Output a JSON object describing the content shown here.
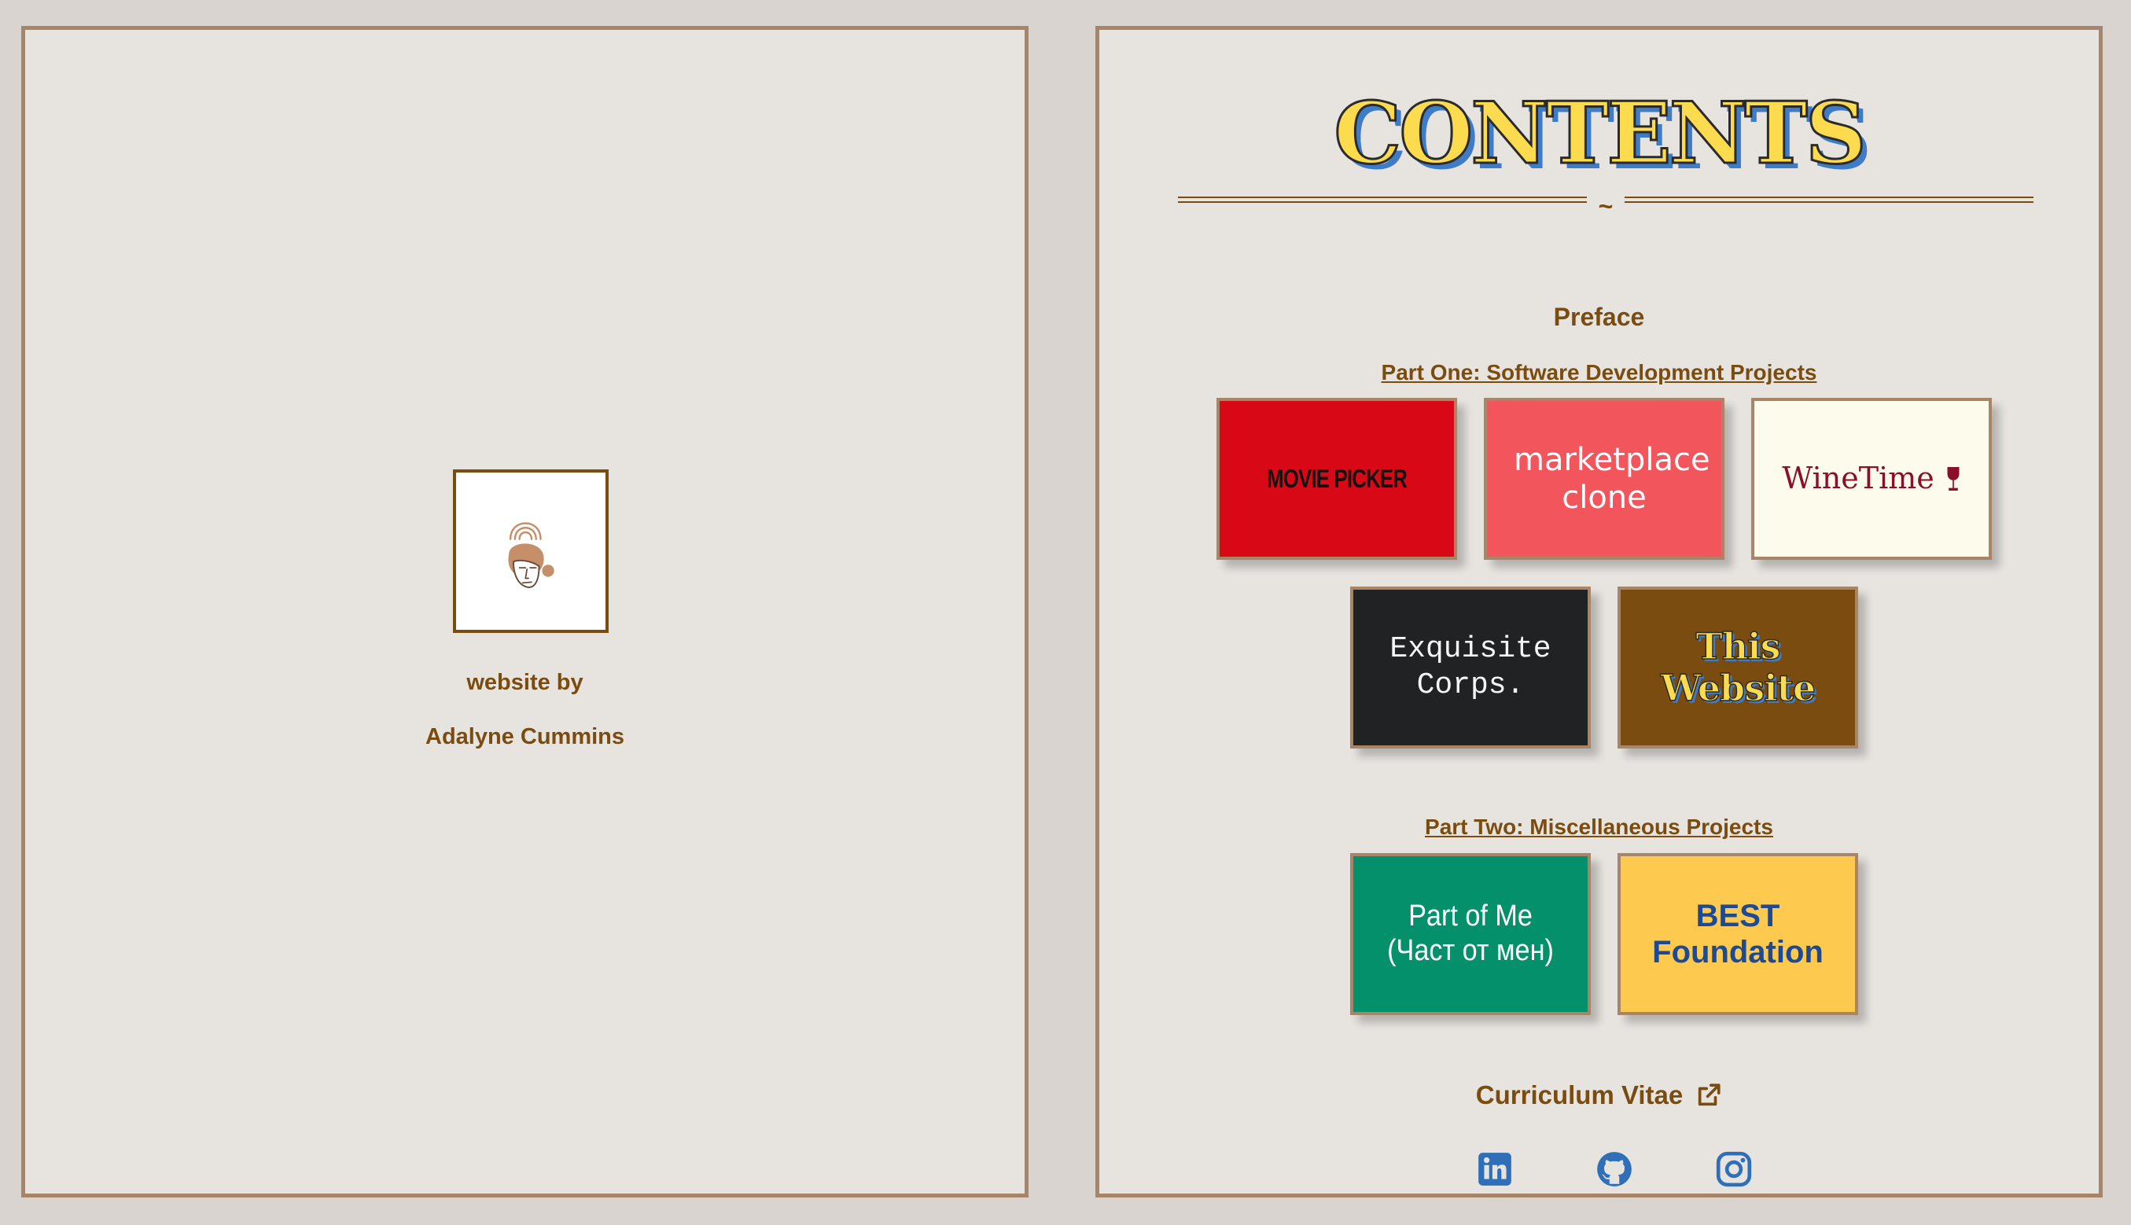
{
  "left_page": {
    "avatar_icon": "woman-illustration-icon",
    "website_by": "website by",
    "author": "Adalyne Cummins"
  },
  "right_page": {
    "title": "CONTENTS",
    "divider_glyph": "~",
    "preface": "Preface",
    "part_one": "Part One: Software Development Projects",
    "part_one_tiles": [
      {
        "label": "MOVIE PICKER",
        "bg": "#d90816"
      },
      {
        "label": "marketplace clone",
        "bg": "#f2565c"
      },
      {
        "label": "WineTime",
        "icon": "wine-glass-icon",
        "bg": "#fdfbeb"
      },
      {
        "label": "Exquisite Corps.",
        "bg": "#212223"
      },
      {
        "label": "This Website",
        "bg": "#7a4c10"
      }
    ],
    "part_two": "Part Two: Miscellaneous Projects",
    "part_two_tiles": [
      {
        "label": "Part of Me (Част от мен)",
        "bg": "#05906c"
      },
      {
        "label": "BEST Foundation",
        "bg": "#fdc94e"
      }
    ],
    "cv_label": "Curriculum Vitae",
    "cv_icon": "external-link-icon",
    "social": [
      "linkedin-icon",
      "github-icon",
      "instagram-icon"
    ]
  },
  "colors": {
    "accent": "#7a4c10",
    "border": "#a88468",
    "page_bg": "#e7e4e0",
    "outer_bg": "#d9d4cf",
    "title_fill": "#fddb4e",
    "title_shadow": "#3f7cc7",
    "social": "#2f6fb8"
  }
}
